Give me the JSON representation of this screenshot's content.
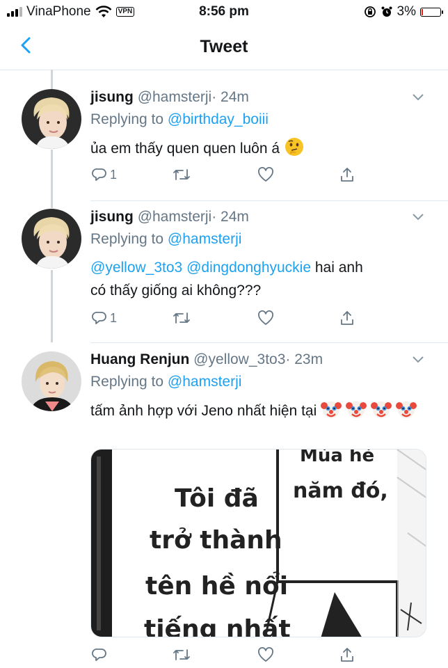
{
  "status_bar": {
    "carrier": "VinaPhone",
    "vpn": "VPN",
    "time": "8:56 pm",
    "battery": "3%"
  },
  "nav": {
    "title": "Tweet"
  },
  "tweets": [
    {
      "name": "jisung",
      "handle": "@hamsterji",
      "time": "· 24m",
      "replying_prefix": "Replying to ",
      "replying_to": "@birthday_boiii",
      "text": "ủa em thấy quen quen luôn á",
      "reply_count": "1"
    },
    {
      "name": "jisung",
      "handle": "@hamsterji",
      "time": "· 24m",
      "replying_prefix": "Replying to ",
      "replying_to": "@hamsterji",
      "mention1": "@yellow_3to3",
      "mention2": "@dingdonghyuckie",
      "text_line1": "hai anh",
      "text_line2": "có thấy giống ai không???",
      "reply_count": "1"
    },
    {
      "name": "Huang Renjun",
      "handle": "@yellow_3to3",
      "time": "· 23m",
      "replying_prefix": "Replying to ",
      "replying_to": "@hamsterji",
      "text": "tấm ảnh hợp với Jeno nhất hiện tại",
      "media_text": {
        "top": "Mùa hè",
        "right": "năm đó,",
        "line1": "Tôi đã",
        "line2": "trở thành",
        "line3": "tên hề nổi",
        "line4": "tiếng nhất"
      }
    }
  ],
  "colors": {
    "link": "#1da1f2",
    "secondary": "#657786",
    "divider": "#e1e8ed"
  }
}
